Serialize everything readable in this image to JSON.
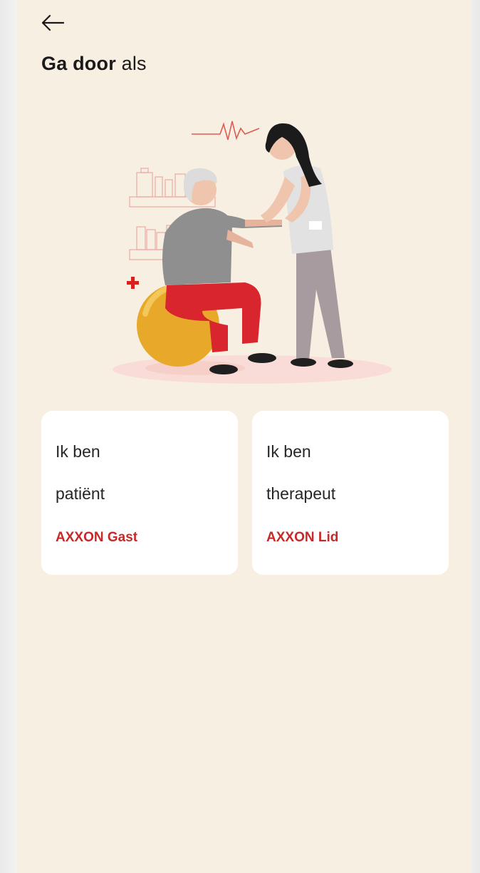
{
  "header": {
    "back_icon": "arrow-left-icon",
    "title_strong": "Ga door",
    "title_rest": " als"
  },
  "options": [
    {
      "line1": "Ik ben",
      "line2": "patiënt",
      "tag": "AXXON Gast"
    },
    {
      "line1": "Ik ben",
      "line2": "therapeut",
      "tag": "AXXON Lid"
    }
  ],
  "colors": {
    "background": "#f8efe3",
    "card": "#ffffff",
    "accent": "#c52a28",
    "text": "#1a1a1a"
  }
}
